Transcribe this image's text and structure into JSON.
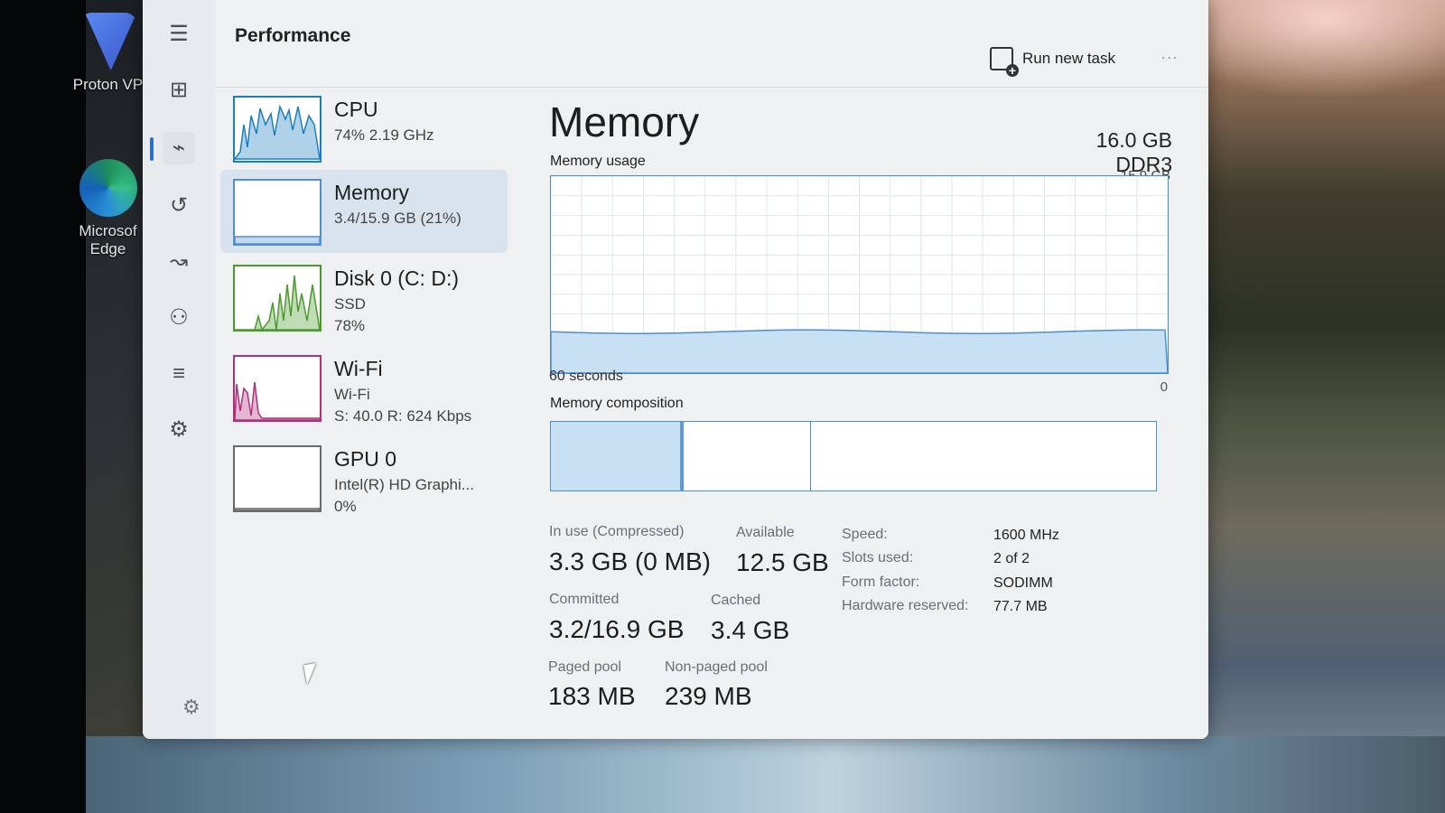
{
  "desktop": {
    "icons": [
      {
        "label": "Proton VP",
        "icon": "proton-vpn-icon"
      },
      {
        "label": "Microsof Edge",
        "icon": "edge-browser-icon"
      }
    ]
  },
  "header": {
    "title": "Performance",
    "run_new_task": "Run new task",
    "more": "..."
  },
  "rail": {
    "items": [
      {
        "name": "hamburger-menu-icon",
        "glyph": "☰"
      },
      {
        "name": "processes-icon",
        "glyph": "⊞"
      },
      {
        "name": "performance-icon",
        "glyph": "⌁"
      },
      {
        "name": "app-history-icon",
        "glyph": "↺"
      },
      {
        "name": "startup-apps-icon",
        "glyph": "↝"
      },
      {
        "name": "users-icon",
        "glyph": "⚇"
      },
      {
        "name": "details-icon",
        "glyph": "≡"
      },
      {
        "name": "services-icon",
        "glyph": "⚙"
      }
    ],
    "settings_glyph": "⚙"
  },
  "resources": [
    {
      "name": "CPU",
      "lines": [
        "74% 2.19 GHz"
      ],
      "selected": false,
      "color": "#1a7fc1"
    },
    {
      "name": "Memory",
      "lines": [
        "3.4/15.9 GB (21%)"
      ],
      "selected": true,
      "color": "#4f8fcf"
    },
    {
      "name": "Disk 0 (C: D:)",
      "lines": [
        "SSD",
        "78%"
      ],
      "selected": false,
      "color": "#4a9a2e"
    },
    {
      "name": "Wi-Fi",
      "lines": [
        "Wi-Fi",
        "S: 40.0 R: 624 Kbps"
      ],
      "selected": false,
      "color": "#b0307a"
    },
    {
      "name": "GPU 0",
      "lines": [
        "Intel(R) HD Graphi...",
        "0%"
      ],
      "selected": false,
      "color": "#6a6a6a"
    }
  ],
  "memory": {
    "title": "Memory",
    "spec": "16.0 GB DDR3",
    "usage_label": "Memory usage",
    "usage_max": "15.9 GB",
    "axis_left": "60 seconds",
    "axis_right": "0",
    "usage_fraction": 0.21,
    "composition_label": "Memory composition",
    "composition": {
      "in_use_fraction": 0.22,
      "standby_fraction": 0.21
    },
    "stats": {
      "in_use_label": "In use (Compressed)",
      "in_use_value": "3.3 GB (0 MB)",
      "available_label": "Available",
      "available_value": "12.5 GB",
      "committed_label": "Committed",
      "committed_value": "3.2/16.9 GB",
      "cached_label": "Cached",
      "cached_value": "3.4 GB",
      "paged_label": "Paged pool",
      "paged_value": "183 MB",
      "nonpaged_label": "Non-paged pool",
      "nonpaged_value": "239 MB"
    },
    "details": [
      {
        "key": "Speed:",
        "value": "1600 MHz"
      },
      {
        "key": "Slots used:",
        "value": "2 of 2"
      },
      {
        "key": "Form factor:",
        "value": "SODIMM"
      },
      {
        "key": "Hardware reserved:",
        "value": "77.7 MB"
      }
    ]
  },
  "colors": {
    "accent": "#4b8fd1",
    "fill": "#c7e0f4"
  }
}
